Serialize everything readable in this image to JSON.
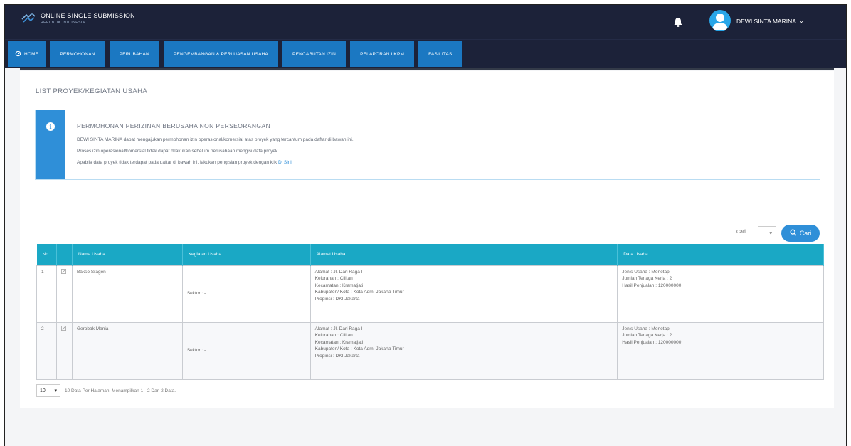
{
  "header": {
    "app_title": "ONLINE SINGLE SUBMISSION",
    "app_subtitle": "REPUBLIK INDONESIA",
    "user_name": "DEWI SINTA MARINA",
    "user_caret": "⌄"
  },
  "nav": {
    "tabs": [
      {
        "label": "HOME"
      },
      {
        "label": "PERMOHONAN"
      },
      {
        "label": "PERUBAHAN"
      },
      {
        "label": "PENGEMBANGAN & PERLUASAN USAHA"
      },
      {
        "label": "PENCABUTAN IZIN"
      },
      {
        "label": "PELAPORAN LKPM"
      },
      {
        "label": "FASILITAS"
      }
    ]
  },
  "page": {
    "section_title": "LIST PROYEK/KEGIATAN USAHA"
  },
  "alert": {
    "title": "PERMOHONAN PERIZINAN BERUSAHA NON PERSEORANGAN",
    "line1": "DEWI SINTA MARINA dapat mengajukan permohonan izin operasional/komersial atas proyek yang tercantum pada daftar di bawah ini.",
    "line2": "Proses izin operasional/komersial tidak dapat dilakukan sebelum perusahaan mengisi data proyek.",
    "line3": "Apabila data proyek tidak terdapat pada daftar di bawah ini, lakukan pengisian proyek dengan klik",
    "line3_link": "Di Sini"
  },
  "search": {
    "label": "Cari",
    "select_value": "▾",
    "button_label": "Cari"
  },
  "table": {
    "headers": [
      "No",
      "",
      "Nama Usaha",
      "Kegiatan Usaha",
      "Alamat Usaha",
      "Data Usaha"
    ],
    "rows": [
      {
        "no": "1",
        "name": "Bakso Sragen",
        "activity": "Sektor : -",
        "address": [
          "Alamat : Jl. Dari Raga I",
          "Kelurahan : Cilitan",
          "Kecamatan : Kramatjati",
          "Kabupaten/ Kota : Kota Adm. Jakarta Timur",
          "Propinsi : DKI Jakarta"
        ],
        "data": [
          "Jenis Usaha : Menetap",
          "Jumlah Tenaga Kerja : 2",
          "Hasil Penjualan : 120000000"
        ]
      },
      {
        "no": "2",
        "name": "Gerobak Mania",
        "activity": "Sektor : -",
        "address": [
          "Alamat : Jl. Dari Raga I",
          "Kelurahan : Cilitan",
          "Kecamatan : Kramatjati",
          "Kabupaten/ Kota : Kota Adm. Jakarta Timur",
          "Propinsi : DKI Jakarta"
        ],
        "data": [
          "Jenis Usaha : Menetap",
          "Jumlah Tenaga Kerja : 2",
          "Hasil Penjualan : 120000000"
        ]
      }
    ]
  },
  "pager": {
    "per_page": "10",
    "info": "10 Data Per Halaman. Menampilkan 1 - 2 Dari 2 Data."
  },
  "colors": {
    "topbar": "#1c2239",
    "tab": "#1b78c2",
    "table_header": "#1aa8c5",
    "alert_accent": "#2f8fd8"
  }
}
